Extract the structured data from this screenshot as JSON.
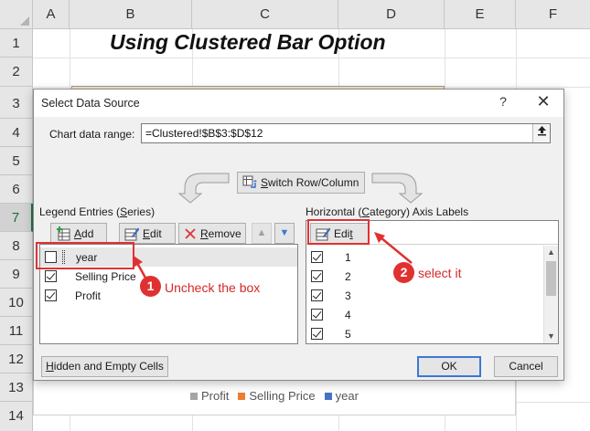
{
  "spreadsheet": {
    "columns": [
      "A",
      "B",
      "C",
      "D",
      "E",
      "F"
    ],
    "rows": [
      "1",
      "2",
      "3",
      "4",
      "5",
      "6",
      "7",
      "8",
      "9",
      "10",
      "11",
      "12",
      "13",
      "14"
    ],
    "active_row": "7",
    "title": "Using Clustered Bar Option",
    "chart_legend": [
      {
        "label": "Profit",
        "color": "#a5a5a5"
      },
      {
        "label": "Selling Price",
        "color": "#ed7d31"
      },
      {
        "label": "year",
        "color": "#4472c4"
      }
    ]
  },
  "dialog": {
    "title": "Select Data Source",
    "help": "?",
    "close": "✕",
    "chart_data_range_label": "Chart data range:",
    "chart_data_range_value": "=Clustered!$B$3:$D$12",
    "collapse_icon": "collapse-range-icon",
    "switch_button": {
      "prefix": "",
      "underlined": "S",
      "rest": "witch Row/Column",
      "icon": "switch-row-column-icon"
    },
    "legend_section": {
      "label_pre": "Legend Entries (",
      "label_u": "S",
      "label_post": "eries)",
      "buttons": {
        "add": {
          "u": "A",
          "rest": "dd",
          "icon": "add-series-icon"
        },
        "edit": {
          "u": "E",
          "rest": "dit",
          "icon": "edit-icon"
        },
        "remove": {
          "u": "R",
          "rest": "emove",
          "icon": "remove-x-icon"
        },
        "up": "▲",
        "down": "▼"
      },
      "entries": [
        {
          "label": "year",
          "checked": false
        },
        {
          "label": "Selling Price",
          "checked": true
        },
        {
          "label": "Profit",
          "checked": true
        }
      ]
    },
    "axis_section": {
      "label_pre": "Horizontal (",
      "label_u": "C",
      "label_post": "ategory) Axis Labels",
      "edit_button": {
        "pre": "Edi",
        "u": "t",
        "icon": "edit-icon"
      },
      "entries": [
        {
          "label": "1",
          "checked": true
        },
        {
          "label": "2",
          "checked": true
        },
        {
          "label": "3",
          "checked": true
        },
        {
          "label": "4",
          "checked": true
        },
        {
          "label": "5",
          "checked": true
        }
      ],
      "scroll_up": "▲",
      "scroll_down": "▼"
    },
    "hidden_cells_button": {
      "u": "H",
      "rest": "idden and Empty Cells"
    },
    "ok_button": "OK",
    "cancel_button": "Cancel"
  },
  "annotations": {
    "step1": {
      "number": "1",
      "text": "Uncheck the box"
    },
    "step2": {
      "number": "2",
      "text": "select it"
    },
    "color": "#e03131"
  }
}
